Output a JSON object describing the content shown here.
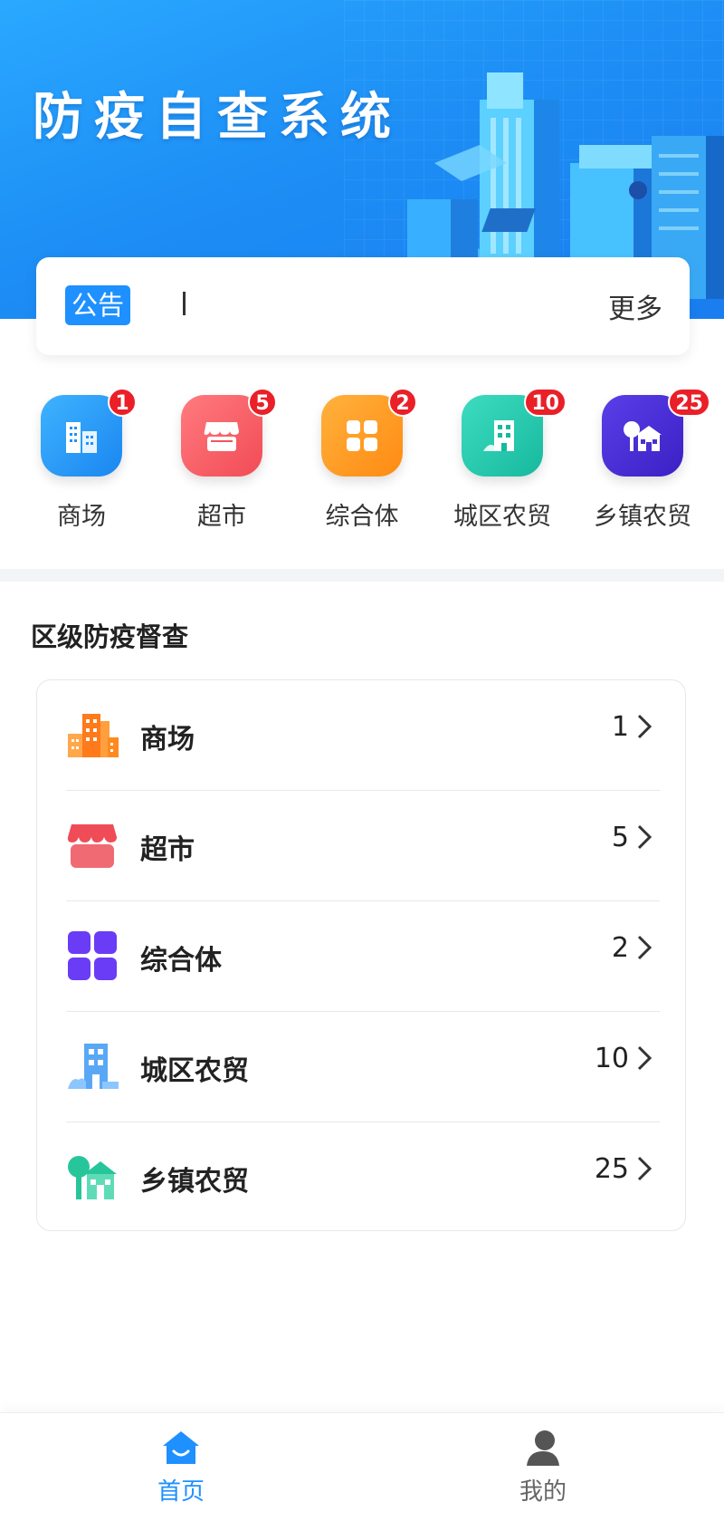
{
  "header": {
    "title": "防疫自查系统"
  },
  "notice": {
    "tag": "公告",
    "more": "更多"
  },
  "categories": [
    {
      "label": "商场",
      "badge": "1",
      "icon": "building-icon",
      "color": "#1e9bff"
    },
    {
      "label": "超市",
      "badge": "5",
      "icon": "store-icon",
      "color": "#ff5a5f"
    },
    {
      "label": "综合体",
      "badge": "2",
      "icon": "grid-icon",
      "color": "#ff9a1f"
    },
    {
      "label": "城区农贸",
      "badge": "10",
      "icon": "city-market-icon",
      "color": "#1fc7ad"
    },
    {
      "label": "乡镇农贸",
      "badge": "25",
      "icon": "town-market-icon",
      "color": "#4a2fd6"
    }
  ],
  "section": {
    "title": "区级防疫督查",
    "rows": [
      {
        "label": "商场",
        "count": "1",
        "icon": "building-icon",
        "color": "#ff8a1f"
      },
      {
        "label": "超市",
        "count": "5",
        "icon": "store-icon",
        "color": "#ef4c57"
      },
      {
        "label": "综合体",
        "count": "2",
        "icon": "grid-icon",
        "color": "#6a3cf5"
      },
      {
        "label": "城区农贸",
        "count": "10",
        "icon": "city-market-icon",
        "color": "#5aa8f5"
      },
      {
        "label": "乡镇农贸",
        "count": "25",
        "icon": "town-market-icon",
        "color": "#27c59a"
      }
    ]
  },
  "nav": {
    "home": {
      "label": "首页",
      "icon": "home-icon",
      "active": true,
      "color": "#1e90ff"
    },
    "mine": {
      "label": "我的",
      "icon": "user-icon",
      "active": false,
      "color": "#666666"
    }
  }
}
